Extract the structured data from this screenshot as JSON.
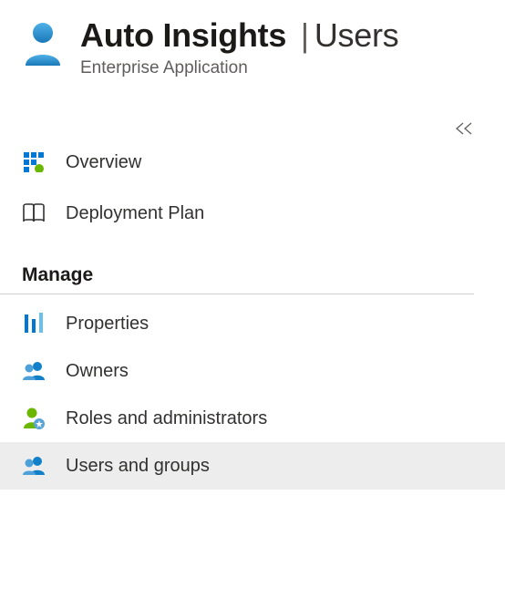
{
  "header": {
    "app_name": "Auto Insights",
    "separator": "|",
    "page": "Users",
    "subtitle": "Enterprise Application"
  },
  "nav": {
    "top": [
      {
        "key": "overview",
        "label": "Overview"
      },
      {
        "key": "deployment-plan",
        "label": "Deployment Plan"
      }
    ],
    "manage_label": "Manage",
    "manage": [
      {
        "key": "properties",
        "label": "Properties"
      },
      {
        "key": "owners",
        "label": "Owners"
      },
      {
        "key": "roles",
        "label": "Roles and administrators"
      },
      {
        "key": "users-groups",
        "label": "Users and groups",
        "selected": true
      }
    ]
  }
}
